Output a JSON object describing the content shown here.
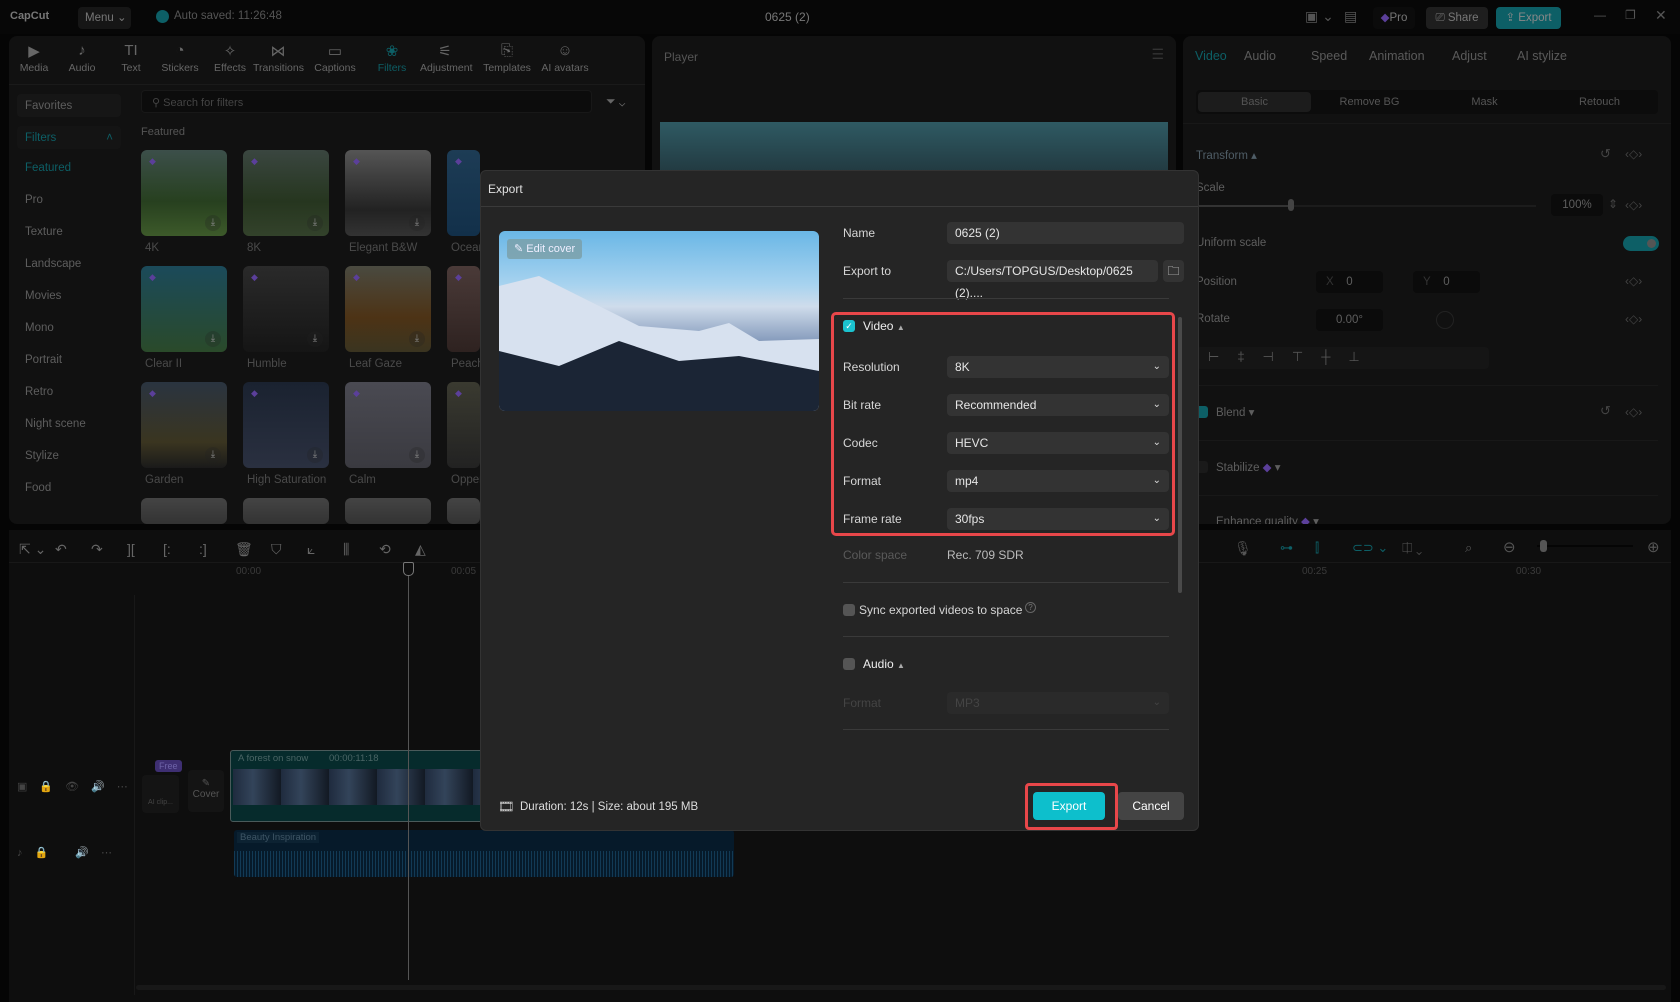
{
  "app": {
    "logo": "CapCut",
    "menu": "Menu",
    "autosave": "Auto saved: 11:26:48",
    "project_title": "0625 (2)",
    "pro": "Pro",
    "share": "Share",
    "export": "Export"
  },
  "toolbar": [
    {
      "label": "Media",
      "icon": "▶"
    },
    {
      "label": "Audio",
      "icon": "♪"
    },
    {
      "label": "Text",
      "icon": "TI"
    },
    {
      "label": "Stickers",
      "icon": "◔"
    },
    {
      "label": "Effects",
      "icon": "✧"
    },
    {
      "label": "Transitions",
      "icon": "⋈"
    },
    {
      "label": "Captions",
      "icon": "▭"
    },
    {
      "label": "Filters",
      "icon": "❀"
    },
    {
      "label": "Adjustment",
      "icon": "⚟"
    },
    {
      "label": "Templates",
      "icon": "⎘"
    },
    {
      "label": "AI avatars",
      "icon": "☺"
    }
  ],
  "filters": {
    "favorites": "Favorites",
    "section": "Filters",
    "search_placeholder": "Search for filters",
    "featured_heading": "Featured",
    "categories": [
      "Featured",
      "Pro",
      "Texture",
      "Landscape",
      "Movies",
      "Mono",
      "Portrait",
      "Retro",
      "Night scene",
      "Stylize",
      "Food"
    ],
    "items": [
      "4K",
      "8K",
      "Elegant B&W",
      "Ocean",
      "Clear II",
      "Humble",
      "Leaf Gaze",
      "Peach",
      "Garden",
      "High Saturation",
      "Calm",
      "Oppenheimer"
    ]
  },
  "player": {
    "title": "Player"
  },
  "inspector": {
    "tabs": [
      "Video",
      "Audio",
      "Speed",
      "Animation",
      "Adjust",
      "AI stylize"
    ],
    "subtabs": [
      "Basic",
      "Remove BG",
      "Mask",
      "Retouch"
    ],
    "transform": "Transform",
    "scale": "Scale",
    "scale_value": "100%",
    "scale_fraction": 0.28,
    "uniform_scale": "Uniform scale",
    "position": "Position",
    "pos_x_label": "X",
    "pos_x": "0",
    "pos_y_label": "Y",
    "pos_y": "0",
    "rotate": "Rotate",
    "rotate_value": "0.00°",
    "blend": "Blend",
    "stabilize": "Stabilize",
    "enhance": "Enhance quality"
  },
  "timeline": {
    "ruler": [
      "00:00",
      "00:05",
      "00:25",
      "00:30"
    ],
    "video_clip": "A forest on snow",
    "video_duration": "00:00:11:18",
    "audio_clip": "Beauty Inspiration",
    "free_badge": "Free",
    "ai_clip": "AI clip...",
    "cover": "Cover"
  },
  "export_dialog": {
    "title": "Export",
    "edit_cover": "Edit cover",
    "name_label": "Name",
    "name_value": "0625 (2)",
    "export_to_label": "Export to",
    "export_to_value": "C:/Users/TOPGUS/Desktop/0625 (2)....",
    "video_label": "Video",
    "video_checked": true,
    "settings": [
      {
        "label": "Resolution",
        "value": "8K"
      },
      {
        "label": "Bit rate",
        "value": "Recommended"
      },
      {
        "label": "Codec",
        "value": "HEVC"
      },
      {
        "label": "Format",
        "value": "mp4"
      },
      {
        "label": "Frame rate",
        "value": "30fps"
      }
    ],
    "color_space_label": "Color space",
    "color_space_value": "Rec. 709 SDR",
    "sync_label": "Sync exported videos to space",
    "audio_label": "Audio",
    "audio_format_label": "Format",
    "audio_format_value": "MP3",
    "footer": "Duration: 12s | Size: about 195 MB",
    "export_button": "Export",
    "cancel_button": "Cancel"
  },
  "colors": {
    "accent": "#1bc3cf",
    "highlight": "#e8474a",
    "dialog_bg": "#252525"
  }
}
